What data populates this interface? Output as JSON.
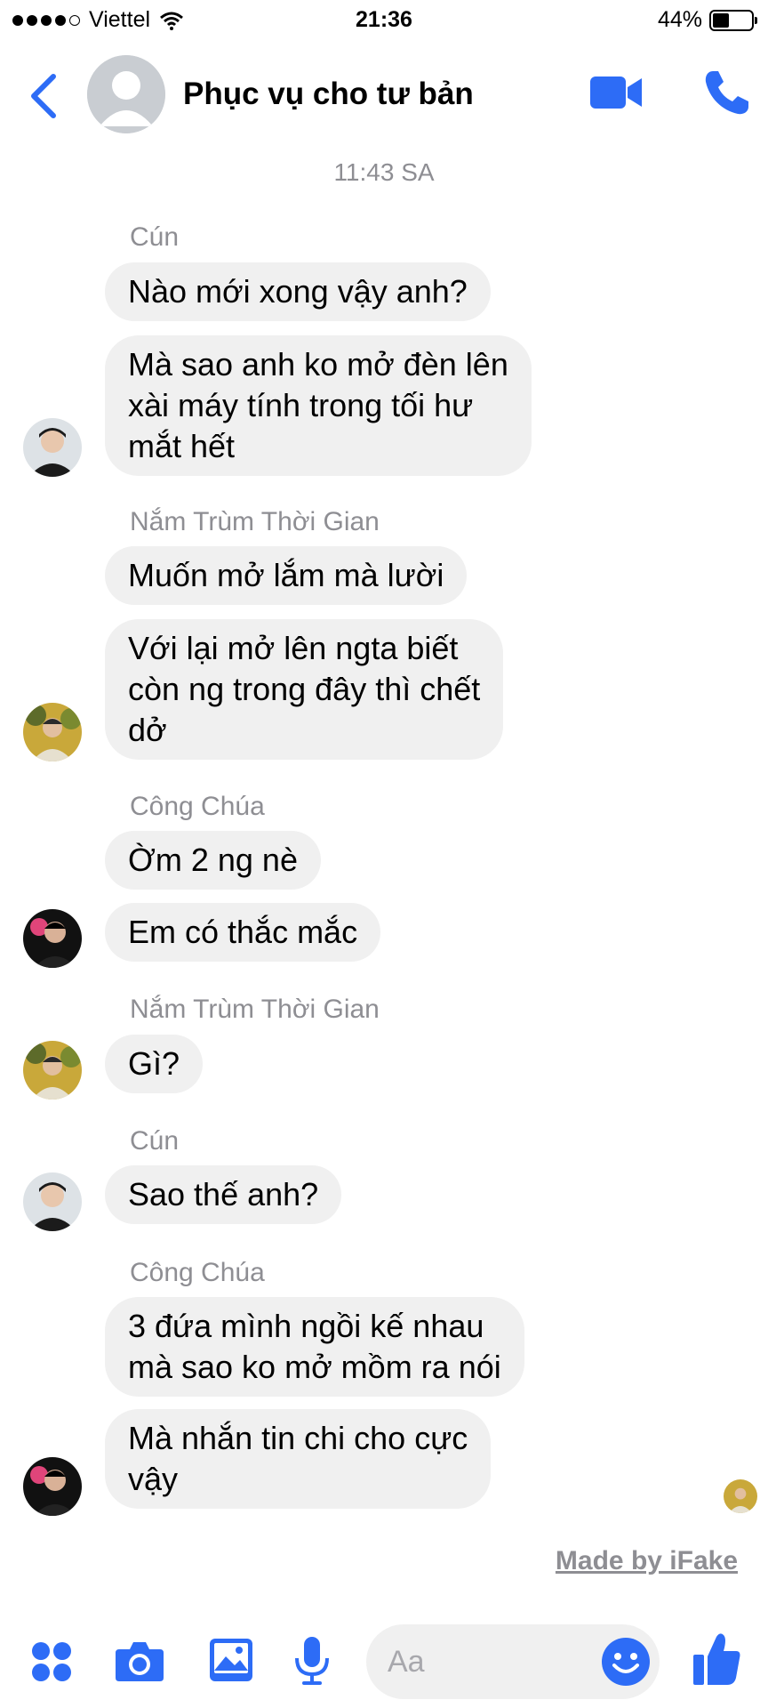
{
  "status_bar": {
    "carrier": "Viettel",
    "time": "21:36",
    "battery_percent": "44%",
    "battery_level": 0.44
  },
  "header": {
    "title": "Phục vụ cho tư bản"
  },
  "timestamp": "11:43 SA",
  "groups": [
    {
      "sender": "Cún",
      "messages": [
        "Nào mới xong vậy anh?",
        "Mà sao anh ko mở đèn lên\nxài máy tính trong tối hư\nmắt hết"
      ]
    },
    {
      "sender": "Nắm Trùm Thời Gian",
      "messages": [
        "Muốn mở lắm mà lười",
        "Với lại mở lên ngta biết\ncòn ng trong đây thì chết\ndở"
      ]
    },
    {
      "sender": "Công Chúa",
      "messages": [
        "Ờm 2 ng nè",
        "Em có thắc mắc"
      ]
    },
    {
      "sender": "Nắm Trùm Thời Gian",
      "messages": [
        "Gì?"
      ]
    },
    {
      "sender": "Cún",
      "messages": [
        "Sao thế anh?"
      ]
    },
    {
      "sender": "Công Chúa",
      "messages": [
        "3 đứa mình ngồi kế nhau\nmà sao ko mở mồm ra nói",
        "Mà nhắn tin chi cho cực\nvậy"
      ]
    }
  ],
  "watermark": "Made by iFake",
  "composer": {
    "placeholder": "Aa"
  },
  "colors": {
    "accent": "#2d6cf6",
    "bubble": "#f0f0f0",
    "secondary_text": "#8e8e93"
  },
  "icons": {
    "back": "chevron-left-icon",
    "video_call": "video-camera-icon",
    "audio_call": "phone-icon",
    "apps": "four-dots-icon",
    "camera": "camera-icon",
    "gallery": "image-icon",
    "voice": "microphone-icon",
    "emoji": "smiley-icon",
    "like": "thumbs-up-icon"
  }
}
